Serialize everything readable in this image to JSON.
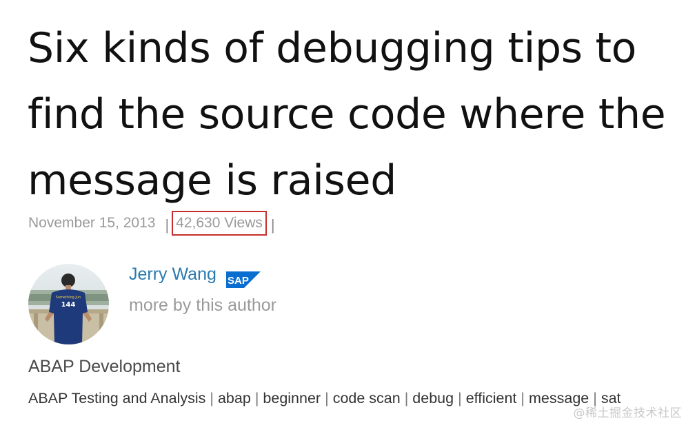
{
  "article": {
    "title": "Six kinds of debugging tips to find the source code where the message is raised",
    "date": "November 15, 2013",
    "separator": "|",
    "views": "42,630 Views"
  },
  "author": {
    "name": "Jerry Wang",
    "badge_text": "SAP",
    "more_link": "more by this author",
    "avatar_jersey_number": "144",
    "brand_color": "#0a6ed1",
    "link_color": "#2a7ab0"
  },
  "category": "ABAP Development",
  "tags": [
    "ABAP Testing and Analysis",
    "abap",
    "beginner",
    "code scan",
    "debug",
    "efficient",
    "message",
    "sat"
  ],
  "watermark": "@稀土掘金技术社区",
  "highlight_color": "#c62d2d"
}
